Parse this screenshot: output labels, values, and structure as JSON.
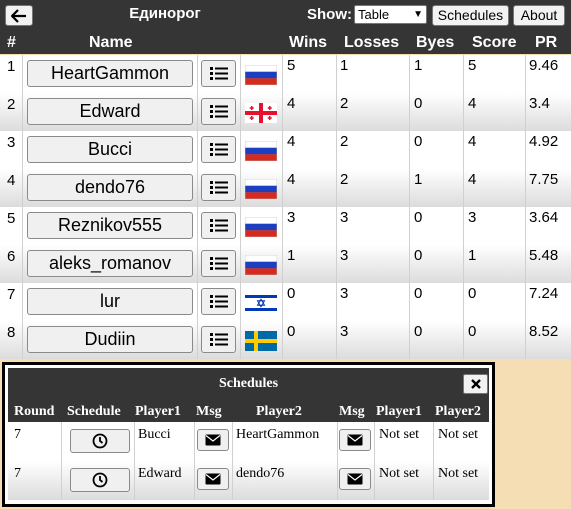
{
  "header": {
    "title": "Единорог",
    "show_label": "Show:",
    "show_value": "Table",
    "schedules_label": "Schedules",
    "about_label": "About"
  },
  "columns": [
    "#",
    "Name",
    "Wins",
    "Losses",
    "Byes",
    "Score",
    "PR"
  ],
  "rows": [
    {
      "n": "1",
      "name": "HeartGammon",
      "flag": "russia-flag",
      "wins": "5",
      "losses": "1",
      "byes": "1",
      "score": "5",
      "pr": "9.46"
    },
    {
      "n": "2",
      "name": "Edward",
      "flag": "georgia-flag",
      "wins": "4",
      "losses": "2",
      "byes": "0",
      "score": "4",
      "pr": "3.4"
    },
    {
      "n": "3",
      "name": "Bucci",
      "flag": "russia-flag",
      "wins": "4",
      "losses": "2",
      "byes": "0",
      "score": "4",
      "pr": "4.92"
    },
    {
      "n": "4",
      "name": "dendo76",
      "flag": "russia-flag",
      "wins": "4",
      "losses": "2",
      "byes": "1",
      "score": "4",
      "pr": "7.75"
    },
    {
      "n": "5",
      "name": "Reznikov555",
      "flag": "russia-flag",
      "wins": "3",
      "losses": "3",
      "byes": "0",
      "score": "3",
      "pr": "3.64"
    },
    {
      "n": "6",
      "name": "aleks_romanov",
      "flag": "russia-flag",
      "wins": "1",
      "losses": "3",
      "byes": "0",
      "score": "1",
      "pr": "5.48"
    },
    {
      "n": "7",
      "name": "lur",
      "flag": "israel-flag",
      "wins": "0",
      "losses": "3",
      "byes": "0",
      "score": "0",
      "pr": "7.24"
    },
    {
      "n": "8",
      "name": "Dudiin",
      "flag": "sweden-flag",
      "wins": "0",
      "losses": "3",
      "byes": "0",
      "score": "0",
      "pr": "8.52"
    }
  ],
  "schedules": {
    "title": "Schedules",
    "columns": [
      "Round",
      "Schedule",
      "Player1",
      "Msg",
      "Player2",
      "Msg",
      "Player1",
      "Player2"
    ],
    "rows": [
      {
        "round": "7",
        "player1": "Bucci",
        "player2": "HeartGammon",
        "p1_status": "Not set",
        "p2_status": "Not set"
      },
      {
        "round": "7",
        "player1": "Edward",
        "player2": "dendo76",
        "p1_status": "Not set",
        "p2_status": "Not set"
      }
    ]
  },
  "colors": {
    "header_bg": "#353535",
    "page_bg": "#f5deb3"
  }
}
